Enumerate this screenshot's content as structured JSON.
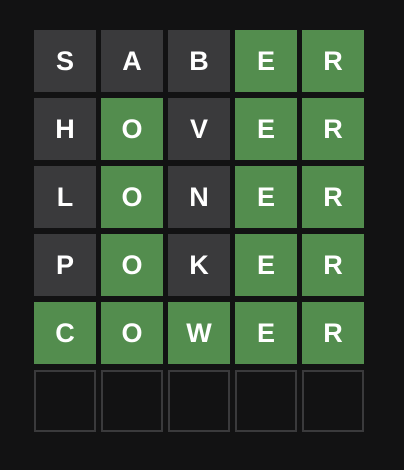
{
  "colors": {
    "background": "#121213",
    "correct": "#538d4e",
    "absent": "#3a3a3c",
    "empty_border": "#3a3a3c"
  },
  "rows": [
    [
      {
        "letter": "S",
        "state": "absent"
      },
      {
        "letter": "A",
        "state": "absent"
      },
      {
        "letter": "B",
        "state": "absent"
      },
      {
        "letter": "E",
        "state": "correct"
      },
      {
        "letter": "R",
        "state": "correct"
      }
    ],
    [
      {
        "letter": "H",
        "state": "absent"
      },
      {
        "letter": "O",
        "state": "correct"
      },
      {
        "letter": "V",
        "state": "absent"
      },
      {
        "letter": "E",
        "state": "correct"
      },
      {
        "letter": "R",
        "state": "correct"
      }
    ],
    [
      {
        "letter": "L",
        "state": "absent"
      },
      {
        "letter": "O",
        "state": "correct"
      },
      {
        "letter": "N",
        "state": "absent"
      },
      {
        "letter": "E",
        "state": "correct"
      },
      {
        "letter": "R",
        "state": "correct"
      }
    ],
    [
      {
        "letter": "P",
        "state": "absent"
      },
      {
        "letter": "O",
        "state": "correct"
      },
      {
        "letter": "K",
        "state": "absent"
      },
      {
        "letter": "E",
        "state": "correct"
      },
      {
        "letter": "R",
        "state": "correct"
      }
    ],
    [
      {
        "letter": "C",
        "state": "correct"
      },
      {
        "letter": "O",
        "state": "correct"
      },
      {
        "letter": "W",
        "state": "correct"
      },
      {
        "letter": "E",
        "state": "correct"
      },
      {
        "letter": "R",
        "state": "correct"
      }
    ],
    [
      {
        "letter": "",
        "state": "empty"
      },
      {
        "letter": "",
        "state": "empty"
      },
      {
        "letter": "",
        "state": "empty"
      },
      {
        "letter": "",
        "state": "empty"
      },
      {
        "letter": "",
        "state": "empty"
      }
    ]
  ]
}
